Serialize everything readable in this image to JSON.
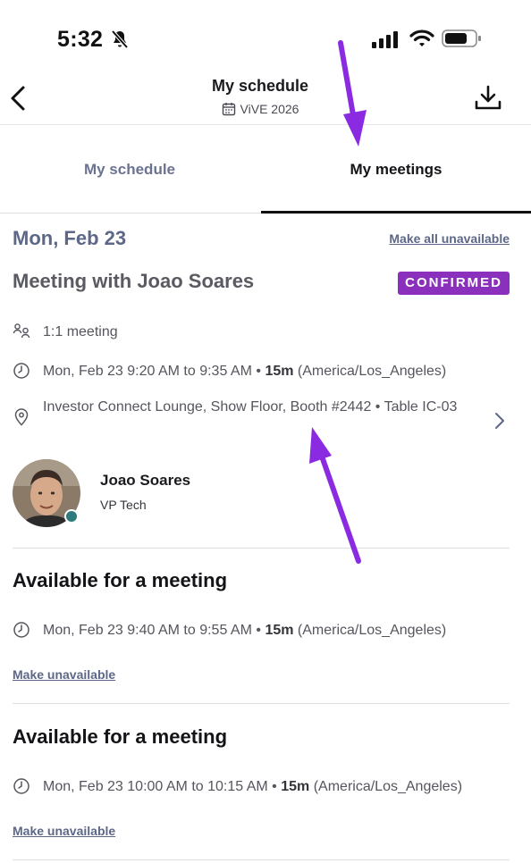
{
  "status_bar": {
    "time": "5:32"
  },
  "header": {
    "title": "My schedule",
    "event_name": "ViVE 2026"
  },
  "tabs": [
    {
      "label": "My schedule",
      "active": false
    },
    {
      "label": "My meetings",
      "active": true
    }
  ],
  "day": {
    "label": "Mon, Feb 23",
    "make_all_unavailable": "Make all unavailable"
  },
  "meeting": {
    "title": "Meeting with Joao Soares",
    "status": "CONFIRMED",
    "type": "1:1 meeting",
    "time_range": "Mon, Feb 23 9:20 AM to 9:35 AM",
    "duration": "15m",
    "timezone": "(America/Los_Angeles)",
    "location": "Investor Connect Lounge, Show Floor, Booth #2442 • Table IC-03",
    "person": {
      "name": "Joao Soares",
      "role": "VP Tech"
    }
  },
  "slots": [
    {
      "title": "Available for a meeting",
      "time_range": "Mon, Feb 23 9:40 AM to 9:55 AM",
      "duration": "15m",
      "timezone": "(America/Los_Angeles)",
      "action": "Make unavailable"
    },
    {
      "title": "Available for a meeting",
      "time_range": "Mon, Feb 23 10:00 AM to 10:15 AM",
      "duration": "15m",
      "timezone": "(America/Los_Angeles)",
      "action": "Make unavailable"
    }
  ],
  "separator": "•",
  "colors": {
    "accent_purple": "#8b2fbd",
    "annotation_arrow": "#8a2be2",
    "muted_slate": "#5d6787"
  }
}
